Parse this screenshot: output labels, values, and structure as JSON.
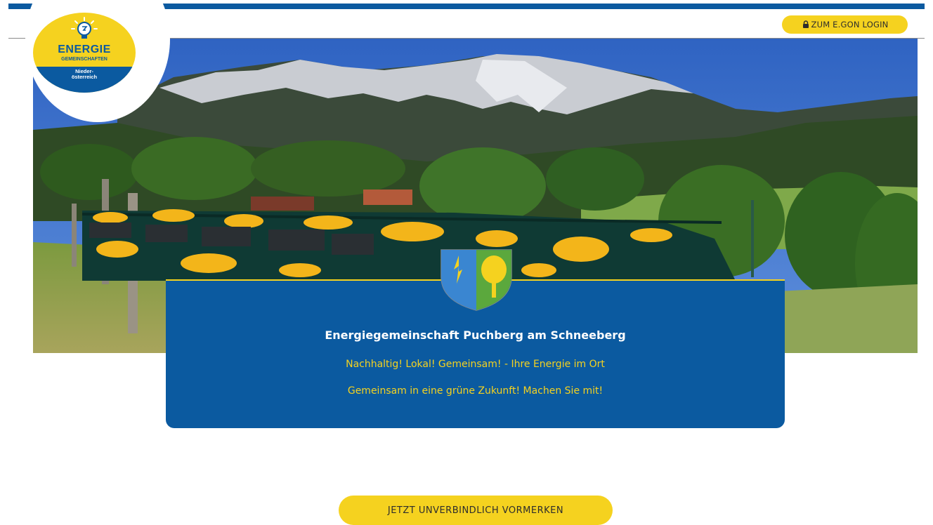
{
  "header": {
    "login_label": "ZUM E.GON LOGIN",
    "login_icon": "lock-icon"
  },
  "logo": {
    "title": "ENERGIE",
    "subtitle": "GEMEINSCHAFTEN",
    "region": "Nieder-\nösterreich",
    "icon": "lightbulb-icon"
  },
  "hero": {
    "image": "mountain-train-landscape"
  },
  "info": {
    "title": "Energiegemeinschaft Puchberg am Schneeberg",
    "line1": "Nachhaltig! Lokal! Gemeinsam! - Ihre Energie im Ort",
    "line2": "Gemeinsam in eine grüne Zukunft! Machen Sie mit!",
    "crest_icon": "coat-of-arms-icon"
  },
  "cta": {
    "label": "JETZT UNVERBINDLICH VORMERKEN"
  },
  "colors": {
    "brand_blue": "#0b5aa0",
    "brand_yellow": "#f5d21f"
  }
}
